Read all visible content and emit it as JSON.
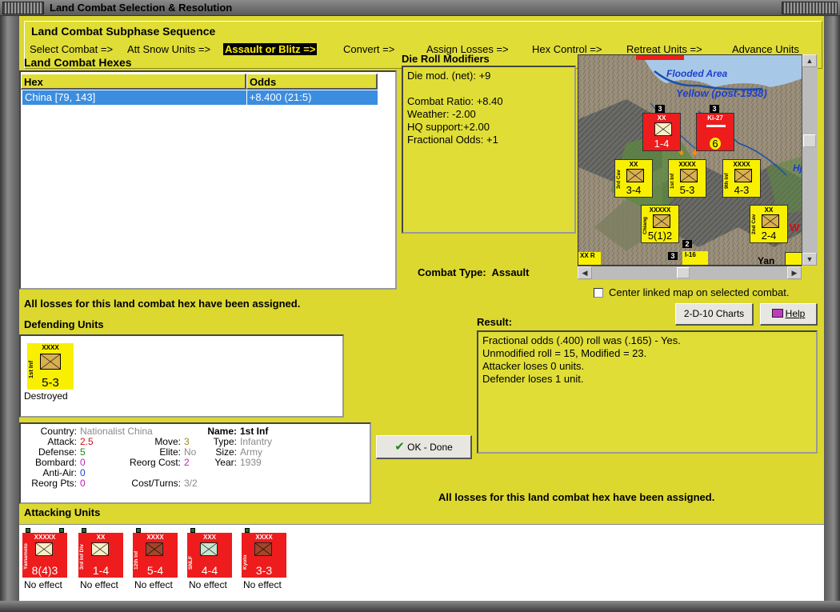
{
  "window": {
    "title": "Land Combat Selection & Resolution"
  },
  "subphase": {
    "title": "Land Combat Subphase Sequence",
    "steps": [
      "Select Combat =>",
      "Att Snow Units =>",
      "Assault or Blitz =>",
      "Convert =>",
      "Assign Losses =>",
      "Hex Control =>",
      "Retreat Units =>",
      "Advance Units"
    ],
    "active_index": 2
  },
  "hexes": {
    "title": "Land Combat Hexes",
    "headers": [
      "Hex",
      "Odds"
    ],
    "rows": [
      {
        "hex": "China [79, 143]",
        "odds": "+8.400 (21:5)"
      }
    ]
  },
  "drm": {
    "title": "Die Roll Modifiers",
    "lines": [
      "Die mod. (net): +9",
      "",
      "Combat Ratio: +8.40",
      "Weather: -2.00",
      "HQ support:+2.00",
      "Fractional Odds: +1"
    ]
  },
  "map": {
    "labels": {
      "flooded": "Flooded Area",
      "yellow": "Yellow (post-1938)",
      "hj": "Hj",
      "w": "W",
      "yan": "Yan"
    },
    "counters": [
      {
        "size": "XX",
        "name": "",
        "strength": "1-4",
        "color": "red"
      },
      {
        "size": "Ki-27",
        "name": "",
        "strength": "6",
        "color": "red"
      },
      {
        "size": "XX",
        "name": "3rd Cav",
        "strength": "3-4",
        "color": "yellow"
      },
      {
        "size": "XXXX",
        "name": "1st Inf",
        "strength": "5-3",
        "color": "yellow"
      },
      {
        "size": "XXXX",
        "name": "9th Inf",
        "strength": "4-3",
        "color": "yellow"
      },
      {
        "size": "XXXXX",
        "name": "Chiang",
        "strength": "5(1)2",
        "color": "yellow"
      },
      {
        "size": "XX",
        "name": "2nd Cav",
        "strength": "2-4",
        "color": "yellow"
      }
    ],
    "stack_numbers": [
      "3",
      "3",
      "2",
      "3"
    ],
    "misc": {
      "xx": "XX",
      "r": "R",
      "i16": "I-16"
    }
  },
  "combat_type": {
    "label": "Combat Type:",
    "value": "Assault"
  },
  "center_checkbox": {
    "label": "Center linked map on selected combat.",
    "checked": false
  },
  "messages": {
    "losses_assigned": "All losses for this land combat hex have been assigned.",
    "losses_assigned_2": "All losses for this land combat hex have been assigned."
  },
  "buttons": {
    "charts": "2-D-10 Charts",
    "help": "Help",
    "done": "OK - Done"
  },
  "defending": {
    "title": "Defending Units",
    "units": [
      {
        "size": "XXXX",
        "name": "1st Inf",
        "strength": "5-3",
        "status": "Destroyed"
      }
    ]
  },
  "unit_info": {
    "country_label": "Country:",
    "country": "Nationalist China",
    "attack_label": "Attack:",
    "attack": "2.5",
    "defense_label": "Defense:",
    "defense": "5",
    "bombard_label": "Bombard:",
    "bombard": "0",
    "antiair_label": "Anti-Air:",
    "antiair": "0",
    "reorg_pts_label": "Reorg Pts:",
    "reorg_pts": "0",
    "move_label": "Move:",
    "move": "3",
    "elite_label": "Elite:",
    "elite": "No",
    "reorg_cost_label": "Reorg Cost:",
    "reorg_cost": "2",
    "cost_turns_label": "Cost/Turns:",
    "cost_turns": "3/2",
    "name_label": "Name:",
    "name": "1st Inf",
    "type_label": "Type:",
    "type": "Infantry",
    "size_label": "Size:",
    "size": "Army",
    "year_label": "Year:",
    "year": "1939"
  },
  "result": {
    "title": "Result:",
    "lines": [
      "Fractional odds (.400) roll was (.165)  - Yes.",
      "Unmodified roll = 15, Modified = 23.",
      "Attacker loses 0 units.",
      "Defender loses 1 unit."
    ]
  },
  "attacking": {
    "title": "Attacking Units",
    "units": [
      {
        "size": "XXXXX",
        "name": "Yamamoto",
        "strength": "8(4)3",
        "status": "No effect"
      },
      {
        "size": "XX",
        "name": "3rd Inf Div",
        "strength": "1-4",
        "status": "No effect"
      },
      {
        "size": "XXXX",
        "name": "12th Inf",
        "strength": "5-4",
        "status": "No effect"
      },
      {
        "size": "XXX",
        "name": "SNLF",
        "strength": "4-4",
        "status": "No effect"
      },
      {
        "size": "XXXX",
        "name": "Kyoto",
        "strength": "3-3",
        "status": "No effect"
      }
    ]
  },
  "colors": {
    "panel": "#dcd830",
    "selection": "#3b8de0",
    "axis_unit": "#ee1c1c",
    "allied_unit": "#f8f000",
    "active_phase_bg": "#000000",
    "active_phase_fg": "#ffee00"
  }
}
